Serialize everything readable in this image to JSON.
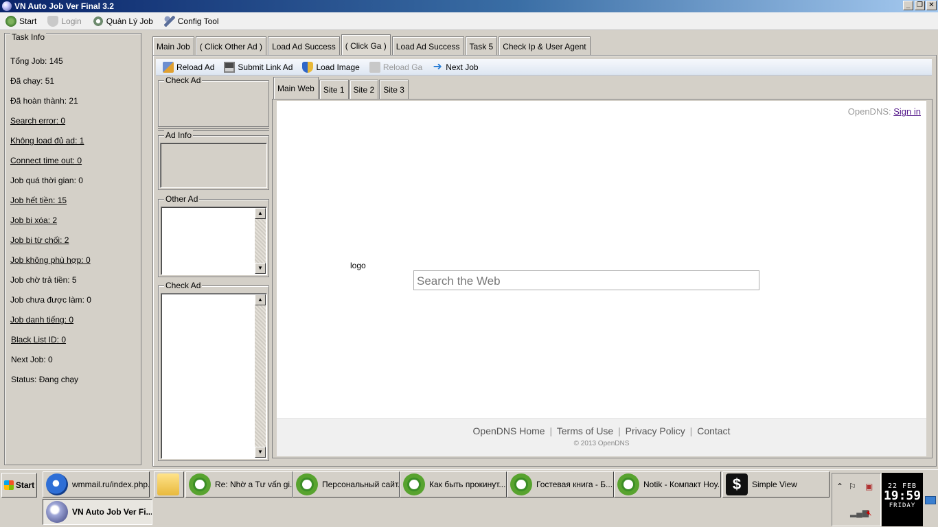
{
  "window": {
    "title": "VN Auto Job Ver Final 3.2"
  },
  "menu": {
    "start": "Start",
    "login": "Login",
    "manage_jobs": "Quản Lý Job",
    "config_tool": "Config Tool"
  },
  "task_info": {
    "legend": "Task Info",
    "rows": [
      "Tổng Job: 145",
      "Đã chạy: 51",
      "Đã hoàn thành: 21",
      "Search error: 0",
      "Không load đủ ad: 1",
      "Connect time out: 0",
      "Job quá thời gian: 0",
      "Job hết tiền: 15",
      "Job bi xóa: 2",
      "Job bi từ chối: 2",
      "Job không phù hợp: 0",
      "Job chờ trả tiền: 5",
      "Job chưa được làm: 0",
      "Job danh tiếng: 0",
      "Black List ID: 0",
      "Next Job: 0",
      "Status: Đang chạy"
    ]
  },
  "tabs": [
    "Main Job",
    "( Click Other Ad )",
    "Load Ad Success",
    "( Click Ga )",
    "Load Ad Success",
    "Task 5",
    "Check Ip & User Agent"
  ],
  "toolbar": {
    "reload_ad": "Reload Ad",
    "submit_link_ad": "Submit Link Ad",
    "load_image": "Load Image",
    "reload_ga": "Reload Ga",
    "next_job": "Next Job"
  },
  "groups": {
    "check_ad_top": "Check Ad",
    "ad_info": "Ad Info",
    "other_ad": "Other Ad",
    "check_ad_bottom": "Check Ad"
  },
  "sub_tabs": [
    "Main Web",
    "Site 1",
    "Site 2",
    "Site 3"
  ],
  "web": {
    "brand": "OpenDNS:",
    "sign_in": "Sign in",
    "logo_alt": "logo",
    "search_placeholder": "Search the Web",
    "footer_links": [
      "OpenDNS Home",
      "Terms of Use",
      "Privacy Policy",
      "Contact"
    ],
    "separator": "|",
    "copyright": "© 2013 OpenDNS"
  },
  "taskbar": {
    "start": "Start",
    "tasks": [
      "wmmail.ru/index.php...",
      "Re: Nhờ a Tư vấn gi...",
      "Персональный сайт...",
      "Как быть прокинут...",
      "Гостевая книга - Б...",
      "Notik - Компакт Hoy...",
      "Simple View",
      "VN Auto Job Ver Fi..."
    ],
    "clock": {
      "date": "22 FEB",
      "time": "19:59",
      "day": "FRIDAY"
    }
  },
  "colors": {
    "title_gradient_start": "#0a246a",
    "toolbar_bg": "#dde6f2",
    "face": "#d4d0c8"
  }
}
